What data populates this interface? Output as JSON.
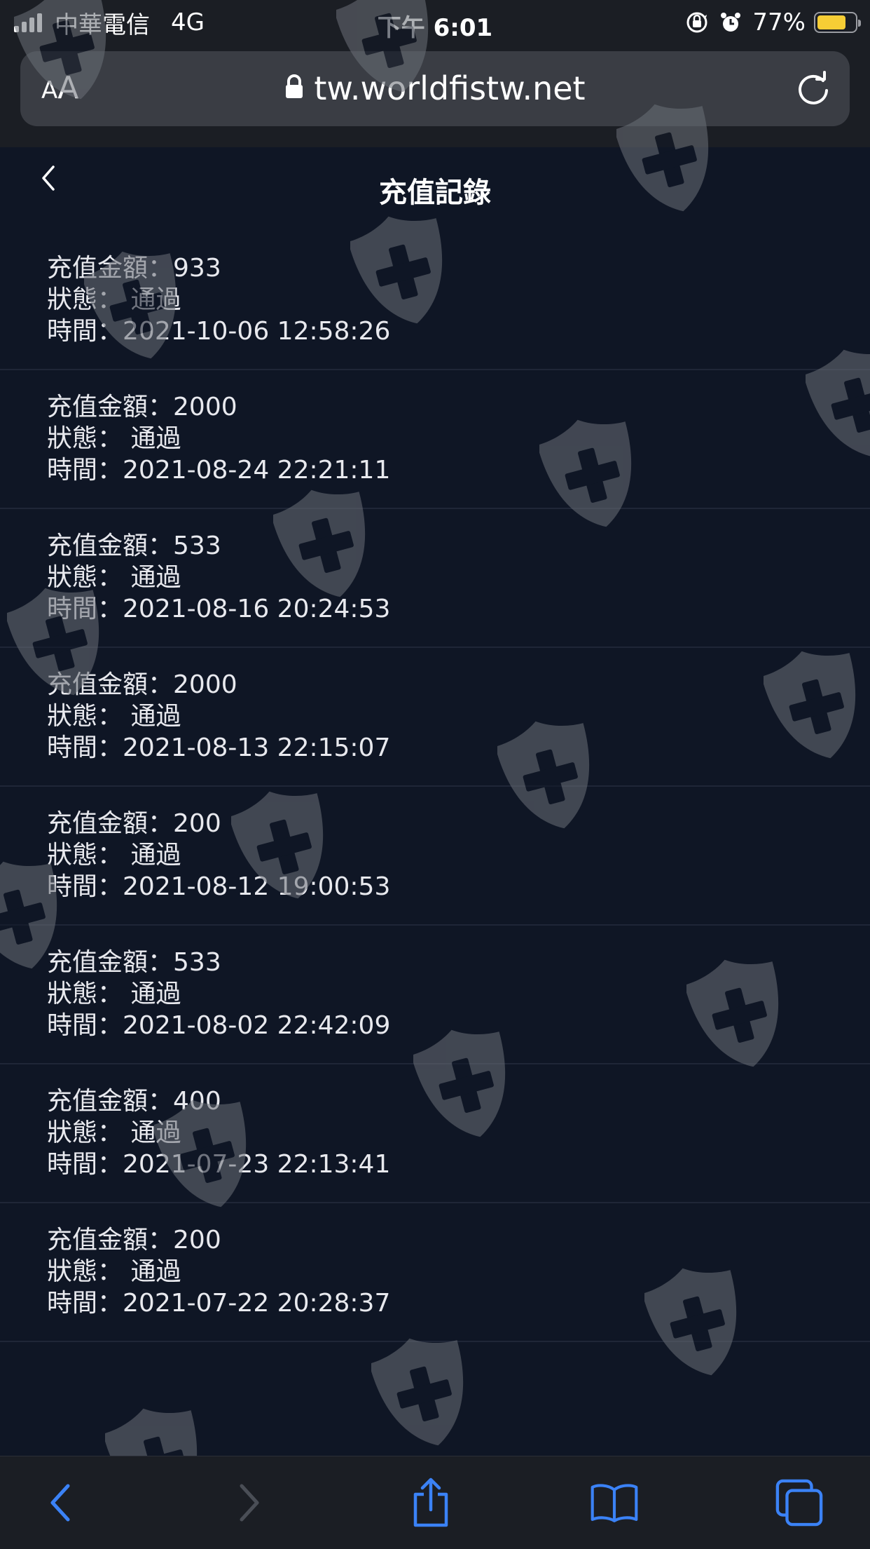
{
  "status_bar": {
    "carrier": "中華電信",
    "network": "4G",
    "time": "下午 6:01",
    "battery_percent": "77%",
    "battery_level": 0.77,
    "icons": [
      "signal-icon",
      "orientation-lock-icon",
      "alarm-icon",
      "battery-icon"
    ]
  },
  "browser": {
    "text_size_label_small": "A",
    "text_size_label_large": "A",
    "url": "tw.worldfistw.net",
    "icons": [
      "lock-icon",
      "reload-icon"
    ]
  },
  "page": {
    "title": "充值記錄",
    "back_icon": "chevron-left-icon"
  },
  "labels": {
    "amount": "充值金額：",
    "status": "狀態： ",
    "time": "時間："
  },
  "records": [
    {
      "amount": "933",
      "status": "通過",
      "time": "2021-10-06 12:58:26"
    },
    {
      "amount": "2000",
      "status": "通過",
      "time": "2021-08-24 22:21:11"
    },
    {
      "amount": "533",
      "status": "通過",
      "time": "2021-08-16 20:24:53"
    },
    {
      "amount": "2000",
      "status": "通過",
      "time": "2021-08-13 22:15:07"
    },
    {
      "amount": "200",
      "status": "通過",
      "time": "2021-08-12 19:00:53"
    },
    {
      "amount": "533",
      "status": "通過",
      "time": "2021-08-02 22:42:09"
    },
    {
      "amount": "400",
      "status": "通過",
      "time": "2021-07-23 22:13:41"
    },
    {
      "amount": "200",
      "status": "通過",
      "time": "2021-07-22 20:28:37"
    }
  ],
  "toolbar": {
    "icons": [
      "back-icon",
      "forward-icon",
      "share-icon",
      "bookmarks-icon",
      "tabs-icon"
    ]
  },
  "colors": {
    "page_background": "#0f1625",
    "browser_chrome": "#1b1e24",
    "url_bar": "#3a3d44",
    "accent_blue": "#3b82f6",
    "battery_yellow": "#f6cd35",
    "watermark": "#6b7078"
  },
  "watermark_icon": "shield-cross-icon"
}
